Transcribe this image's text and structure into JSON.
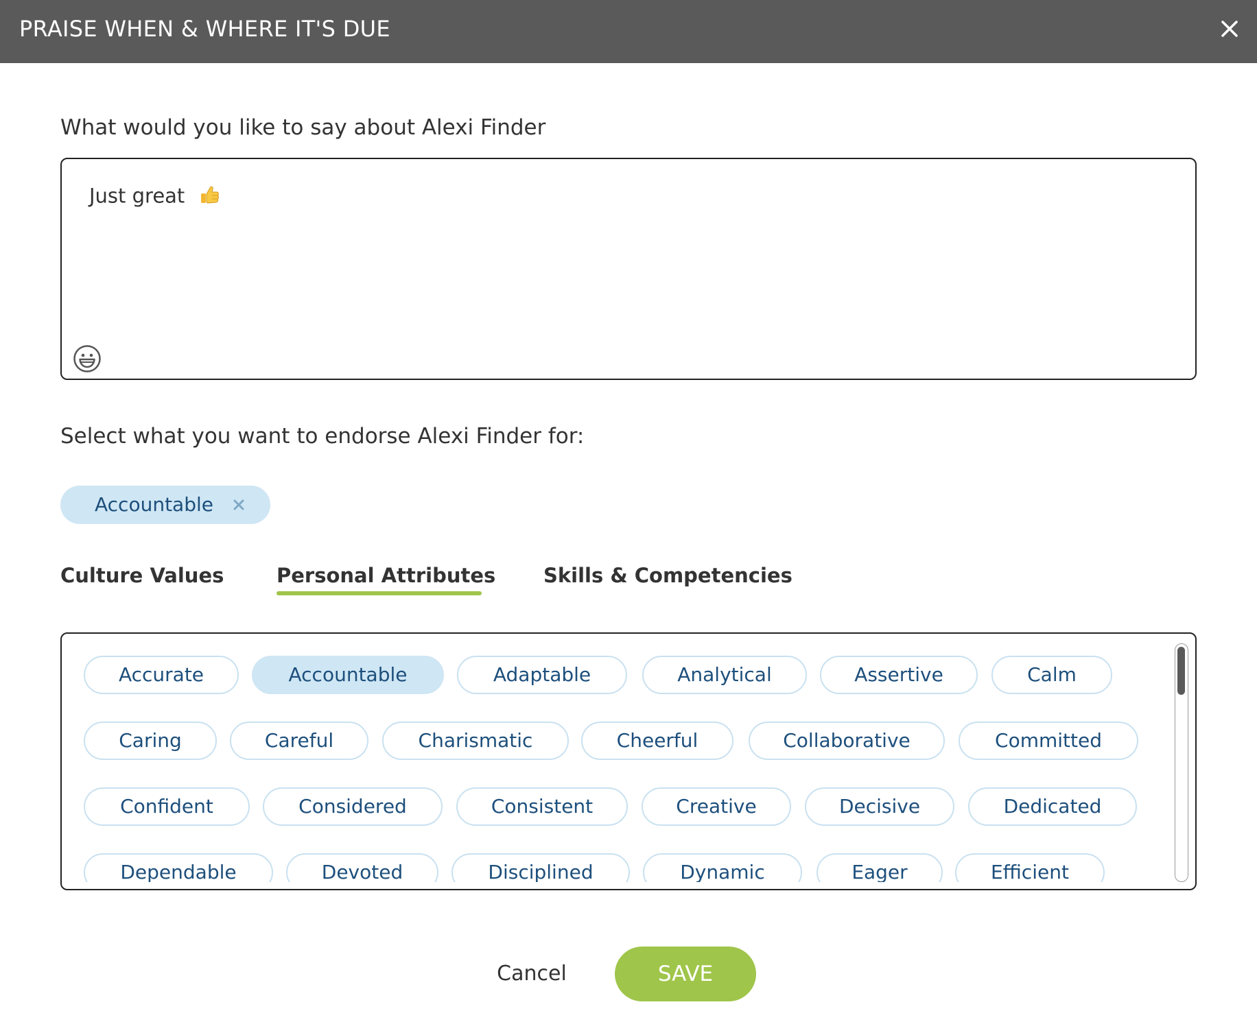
{
  "dialog": {
    "title": "PRAISE WHEN & WHERE IT'S DUE",
    "close_icon": "close-icon"
  },
  "message": {
    "prompt": "What would you like to say about Alexi Finder",
    "value": "Just great",
    "inline_emoji": "thumbs-up-icon",
    "emoji_picker_icon": "smiley-icon"
  },
  "endorse": {
    "prompt": "Select what you want to endorse Alexi Finder for:",
    "selected": [
      {
        "label": "Accountable",
        "remove_icon": "remove-icon"
      }
    ]
  },
  "tabs": [
    {
      "label": "Culture Values",
      "active": false
    },
    {
      "label": "Personal Attributes",
      "active": true
    },
    {
      "label": "Skills & Competencies",
      "active": false
    }
  ],
  "attributes": [
    {
      "label": "Accurate",
      "selected": false
    },
    {
      "label": "Accountable",
      "selected": true
    },
    {
      "label": "Adaptable",
      "selected": false
    },
    {
      "label": "Analytical",
      "selected": false
    },
    {
      "label": "Assertive",
      "selected": false
    },
    {
      "label": "Calm",
      "selected": false
    },
    {
      "label": "Caring",
      "selected": false
    },
    {
      "label": "Careful",
      "selected": false
    },
    {
      "label": "Charismatic",
      "selected": false
    },
    {
      "label": "Cheerful",
      "selected": false
    },
    {
      "label": "Collaborative",
      "selected": false
    },
    {
      "label": "Committed",
      "selected": false
    },
    {
      "label": "Confident",
      "selected": false
    },
    {
      "label": "Considered",
      "selected": false
    },
    {
      "label": "Consistent",
      "selected": false
    },
    {
      "label": "Creative",
      "selected": false
    },
    {
      "label": "Decisive",
      "selected": false
    },
    {
      "label": "Dedicated",
      "selected": false
    },
    {
      "label": "Dependable",
      "selected": false
    },
    {
      "label": "Devoted",
      "selected": false
    },
    {
      "label": "Disciplined",
      "selected": false
    },
    {
      "label": "Dynamic",
      "selected": false
    },
    {
      "label": "Eager",
      "selected": false
    },
    {
      "label": "Efficient",
      "selected": false
    }
  ],
  "actions": {
    "cancel_label": "Cancel",
    "save_label": "SAVE"
  },
  "colors": {
    "header_bg": "#5a5a5a",
    "accent_green": "#9fc54a",
    "chip_selected_bg": "#cfe6f4",
    "chip_border": "#c9e1f0",
    "chip_text": "#1d4f7c"
  }
}
